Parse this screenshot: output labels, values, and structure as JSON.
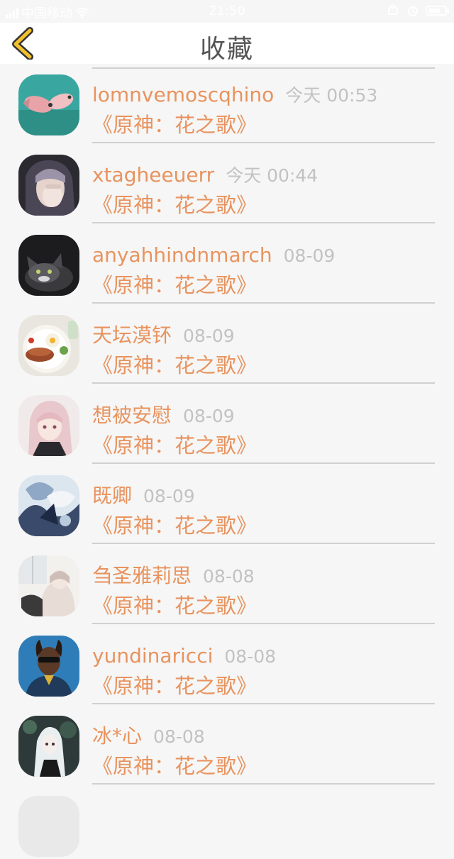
{
  "status_bar": {
    "carrier": "中国移动",
    "time": "21:50"
  },
  "nav": {
    "title": "收藏",
    "back_icon": "chevron-left-icon",
    "accent_color": "#f2c12e"
  },
  "colors": {
    "name": "#e8935e",
    "subtitle": "#e8935e",
    "time": "#c2c2c2",
    "background": "#f6f6f6"
  },
  "favorites": [
    {
      "name": "lomnvemoscqhino",
      "time": "今天 00:53",
      "subtitle": "《原神：花之歌》",
      "avatar": "fish-avatar"
    },
    {
      "name": "xtagheeuerr",
      "time": "今天 00:44",
      "subtitle": "《原神：花之歌》",
      "avatar": "girl-face-avatar"
    },
    {
      "name": "anyahhindnmarch",
      "time": "08-09",
      "subtitle": "《原神：花之歌》",
      "avatar": "kitten-avatar"
    },
    {
      "name": "天坛漠钚",
      "time": "08-09",
      "subtitle": "《原神：花之歌》",
      "avatar": "food-plate-avatar"
    },
    {
      "name": "想被安慰",
      "time": "08-09",
      "subtitle": "《原神：花之歌》",
      "avatar": "anime-girl-avatar"
    },
    {
      "name": "既卿",
      "time": "08-09",
      "subtitle": "《原神：花之歌》",
      "avatar": "anime-art-avatar"
    },
    {
      "name": "刍圣雅莉思",
      "time": "08-08",
      "subtitle": "《原神：花之歌》",
      "avatar": "girl-window-avatar"
    },
    {
      "name": "yundinaricci",
      "time": "08-08",
      "subtitle": "《原神：花之歌》",
      "avatar": "man-sunglasses-avatar"
    },
    {
      "name": "冰*心",
      "time": "08-08",
      "subtitle": "《原神：花之歌》",
      "avatar": "anime-white-hair-avatar"
    }
  ]
}
